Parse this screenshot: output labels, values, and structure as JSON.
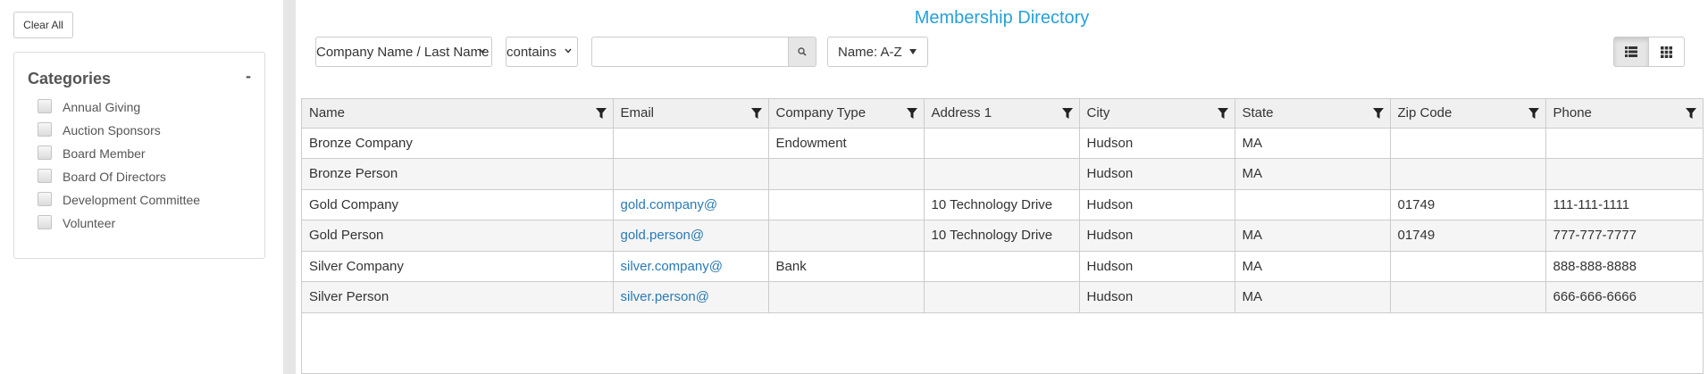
{
  "sidebar": {
    "clear_all_label": "Clear All",
    "categories_title": "Categories",
    "toggle_symbol": "-",
    "items": [
      {
        "label": "Annual Giving"
      },
      {
        "label": "Auction Sponsors"
      },
      {
        "label": "Board Member"
      },
      {
        "label": "Board Of Directors"
      },
      {
        "label": "Development Committee"
      },
      {
        "label": "Volunteer"
      }
    ]
  },
  "header": {
    "title": "Membership Directory",
    "field_select": "Company Name / Last Name",
    "operator_select": "contains",
    "search_value": "",
    "sort_label": "Name: A-Z"
  },
  "table": {
    "columns": [
      "Name",
      "Email",
      "Company Type",
      "Address 1",
      "City",
      "State",
      "Zip Code",
      "Phone"
    ],
    "rows": [
      {
        "name": "Bronze Company",
        "email": "",
        "company_type": "Endowment",
        "address1": "",
        "city": "Hudson",
        "state": "MA",
        "zip": "",
        "phone": ""
      },
      {
        "name": "Bronze Person",
        "email": "",
        "company_type": "",
        "address1": "",
        "city": "Hudson",
        "state": "MA",
        "zip": "",
        "phone": ""
      },
      {
        "name": "Gold Company",
        "email": "gold.company@",
        "company_type": "",
        "address1": "10 Technology Drive",
        "city": "Hudson",
        "state": "",
        "zip": "01749",
        "phone": "111-111-1111"
      },
      {
        "name": "Gold Person",
        "email": "gold.person@",
        "company_type": "",
        "address1": "10 Technology Drive",
        "city": "Hudson",
        "state": "MA",
        "zip": "01749",
        "phone": "777-777-7777"
      },
      {
        "name": "Silver Company",
        "email": "silver.company@",
        "company_type": "Bank",
        "address1": "",
        "city": "Hudson",
        "state": "MA",
        "zip": "",
        "phone": "888-888-8888"
      },
      {
        "name": "Silver Person",
        "email": "silver.person@",
        "company_type": "",
        "address1": "",
        "city": "Hudson",
        "state": "MA",
        "zip": "",
        "phone": "666-666-6666"
      }
    ]
  },
  "colors": {
    "accent": "#27a0d8",
    "link": "#2a7ab5"
  }
}
